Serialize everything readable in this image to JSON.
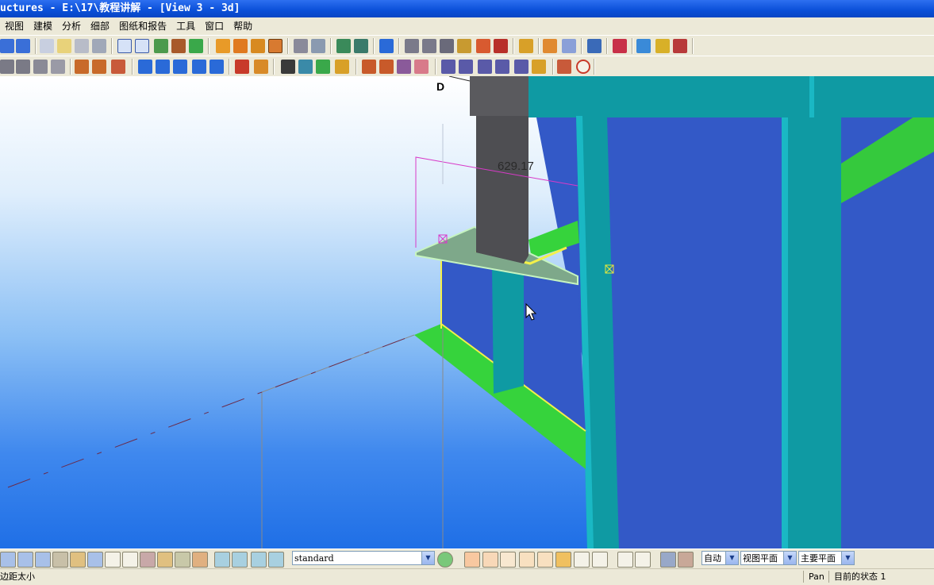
{
  "window": {
    "title": "uctures - E:\\17\\教程讲解 - [View 3 - 3d]"
  },
  "menu": [
    "视图",
    "建模",
    "分析",
    "细部",
    "图纸和报告",
    "工具",
    "窗口",
    "帮助"
  ],
  "viewport": {
    "axis_label": "D",
    "dimension_value": "629.17"
  },
  "bottom_toolbar": {
    "filter_combo_value": "standard",
    "select_auto": "自动",
    "select_view_plane": "视图平面",
    "select_main_plane": "主要平面"
  },
  "status": {
    "left_text": "边距太小",
    "mode": "Pan",
    "state": "目前的状态 1"
  },
  "colors": {
    "beam_teal": "#0f9aa3",
    "plate_green": "#36d33c",
    "column_dark": "#5a5a5e",
    "highlight_yellow": "#f3f04a",
    "sky_top": "#ffffff",
    "sky_bottom": "#1f6fe6"
  }
}
